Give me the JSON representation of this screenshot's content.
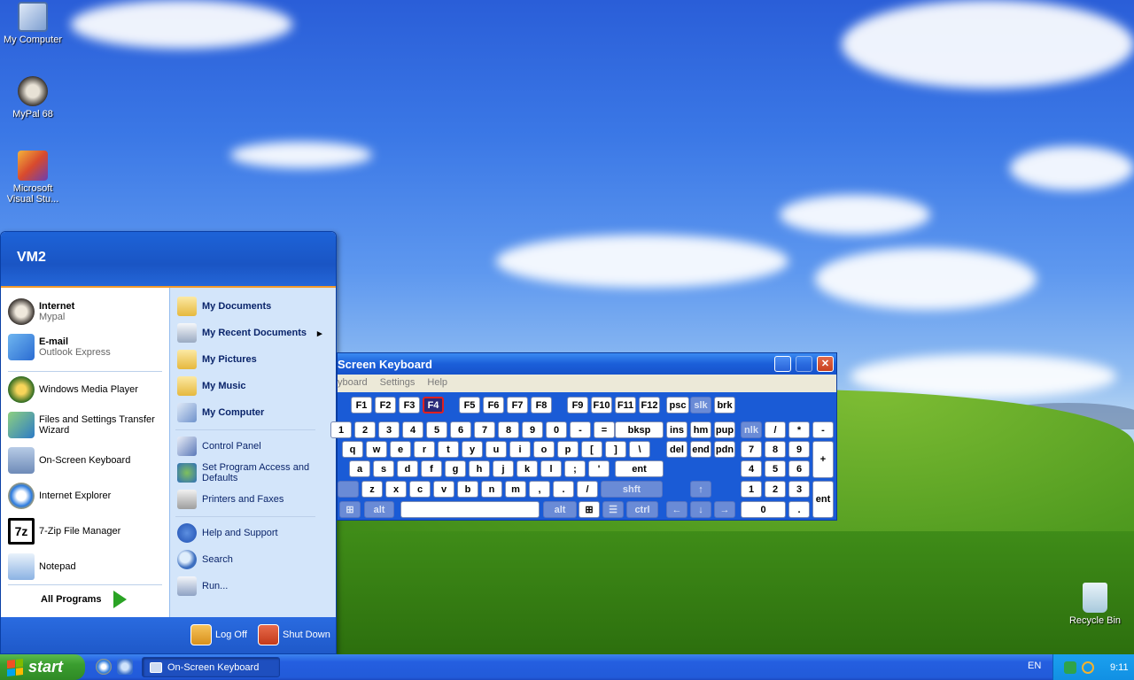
{
  "desktop": {
    "icons": [
      {
        "label": "My Computer",
        "icon": "my-computer-icon"
      },
      {
        "label": "MyPal 68",
        "icon": "mypal-icon"
      },
      {
        "label": "Microsoft Visual Stu...",
        "icon": "visual-studio-icon"
      },
      {
        "label": "Recycle Bin",
        "icon": "recycle-bin-icon"
      }
    ]
  },
  "start_menu": {
    "user": "VM2",
    "pinned": [
      {
        "title": "Internet",
        "subtitle": "Mypal"
      },
      {
        "title": "E-mail",
        "subtitle": "Outlook Express"
      }
    ],
    "recent": [
      "Windows Media Player",
      "Files and Settings Transfer Wizard",
      "On-Screen Keyboard",
      "Internet Explorer",
      "7-Zip File Manager",
      "Notepad"
    ],
    "all_programs": "All Programs",
    "right": {
      "bold": [
        "My Documents",
        "My Recent Documents",
        "My Pictures",
        "My Music",
        "My Computer"
      ],
      "normal": [
        "Control Panel",
        "Set Program Access and Defaults",
        "Printers and Faxes"
      ],
      "bottom": [
        "Help and Support",
        "Search",
        "Run..."
      ]
    },
    "log_off": "Log Off",
    "shut_down": "Shut Down"
  },
  "osk": {
    "title": "Screen Keyboard",
    "menu": [
      "yboard",
      "Settings",
      "Help"
    ],
    "fkeys": [
      "F1",
      "F2",
      "F3",
      "F4",
      "F5",
      "F6",
      "F7",
      "F8",
      "F9",
      "F10",
      "F11",
      "F12"
    ],
    "special_top": [
      "psc",
      "slk",
      "brk"
    ],
    "row1": [
      "1",
      "2",
      "3",
      "4",
      "5",
      "6",
      "7",
      "8",
      "9",
      "0",
      "-",
      "=",
      "bksp"
    ],
    "row2": [
      "q",
      "w",
      "e",
      "r",
      "t",
      "y",
      "u",
      "i",
      "o",
      "p",
      "[",
      "]",
      "\\"
    ],
    "row3": [
      "a",
      "s",
      "d",
      "f",
      "g",
      "h",
      "j",
      "k",
      "l",
      ";",
      "'",
      "ent"
    ],
    "row4": [
      "z",
      "x",
      "c",
      "v",
      "b",
      "n",
      "m",
      ",",
      ".",
      "/",
      "shft"
    ],
    "row5": [
      "alt",
      "alt",
      "ctrl"
    ],
    "nav1": [
      "ins",
      "hm",
      "pup"
    ],
    "nav2": [
      "del",
      "end",
      "pdn"
    ],
    "num1": [
      "nlk",
      "/",
      "*",
      "-"
    ],
    "num2": [
      "7",
      "8",
      "9"
    ],
    "num3": [
      "4",
      "5",
      "6",
      "+"
    ],
    "num4": [
      "1",
      "2",
      "3"
    ],
    "num5": [
      "0",
      ".",
      "ent"
    ],
    "active_key": "F4"
  },
  "taskbar": {
    "start": "start",
    "task": "On-Screen Keyboard",
    "lang": "EN",
    "clock": "9:11"
  }
}
